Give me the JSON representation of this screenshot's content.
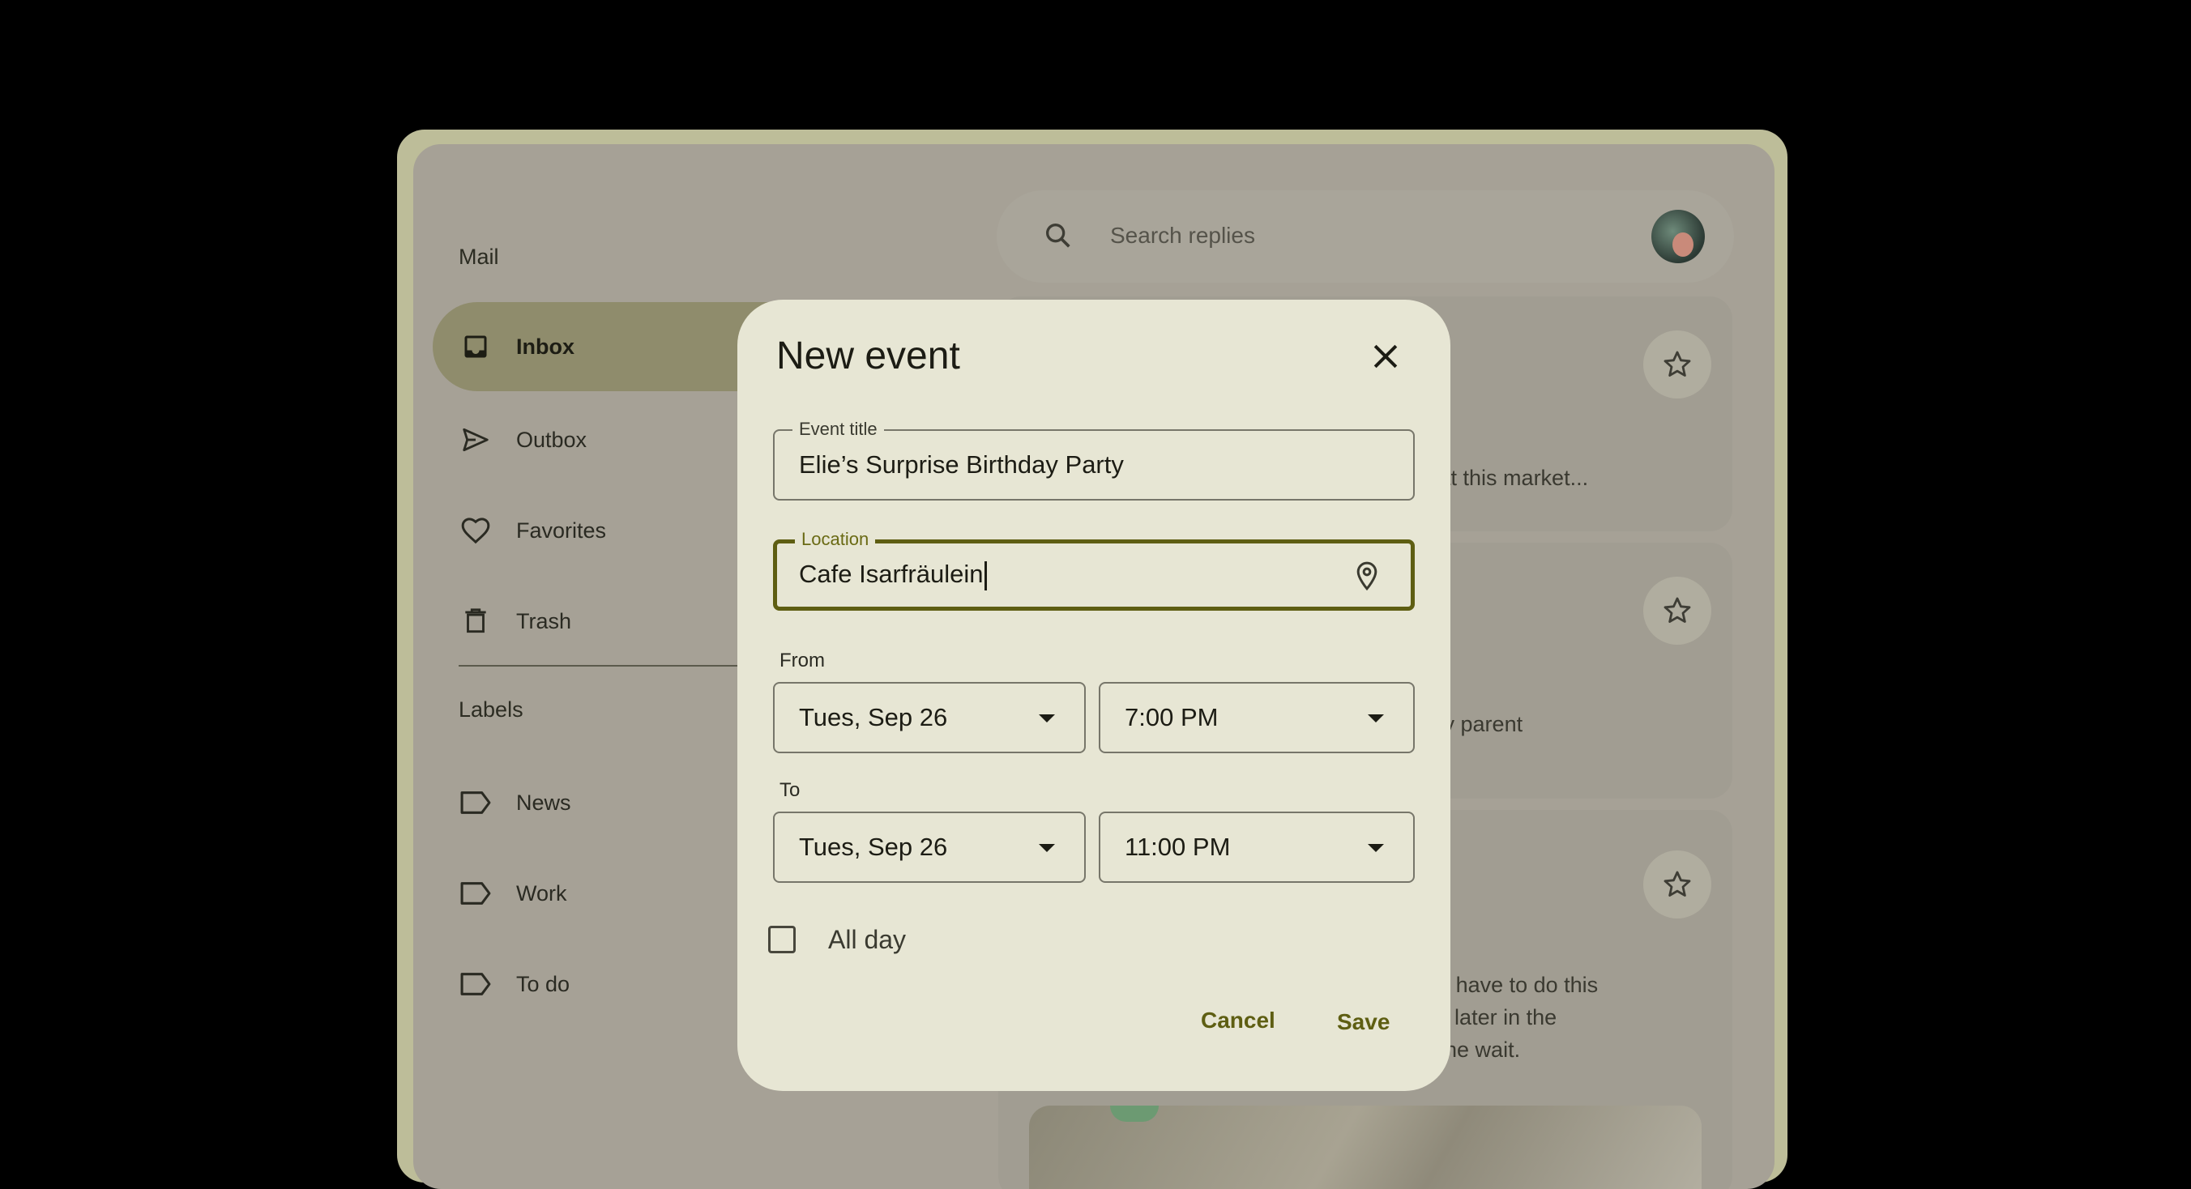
{
  "sidebar": {
    "title": "Mail",
    "items": [
      {
        "label": "Inbox",
        "icon": "inbox-icon",
        "active": true
      },
      {
        "label": "Outbox",
        "icon": "send-icon",
        "active": false
      },
      {
        "label": "Favorites",
        "icon": "heart-icon",
        "active": false
      },
      {
        "label": "Trash",
        "icon": "trash-icon",
        "active": false
      }
    ],
    "labels_title": "Labels",
    "labels": [
      {
        "label": "News",
        "icon": "label-icon"
      },
      {
        "label": "Work",
        "icon": "label-icon"
      },
      {
        "label": "To do",
        "icon": "label-icon"
      }
    ]
  },
  "search": {
    "placeholder": "Search replies"
  },
  "cards": [
    {
      "snippet": "sures at this market..."
    },
    {
      "snippet": "w many parent"
    },
    {
      "snippet_lines": [
        "and we have to do this",
        "ait until later in the",
        "worth the wait."
      ]
    }
  ],
  "dialog": {
    "title": "New event",
    "event_title_label": "Event title",
    "event_title_value": "Elie’s Surprise Birthday Party",
    "location_label": "Location",
    "location_value": "Cafe Isarfräulein",
    "from_label": "From",
    "from_date": "Tues, Sep 26",
    "from_time": "7:00 PM",
    "to_label": "To",
    "to_date": "Tues, Sep 26",
    "to_time": "11:00 PM",
    "all_day_label": "All day",
    "all_day_checked": false,
    "cancel_label": "Cancel",
    "save_label": "Save"
  },
  "colors": {
    "accent": "#5e5e12",
    "dialog_bg": "#e7e6d4",
    "scrim_bg": "#a6a196",
    "active_nav": "#8f8c6c"
  }
}
